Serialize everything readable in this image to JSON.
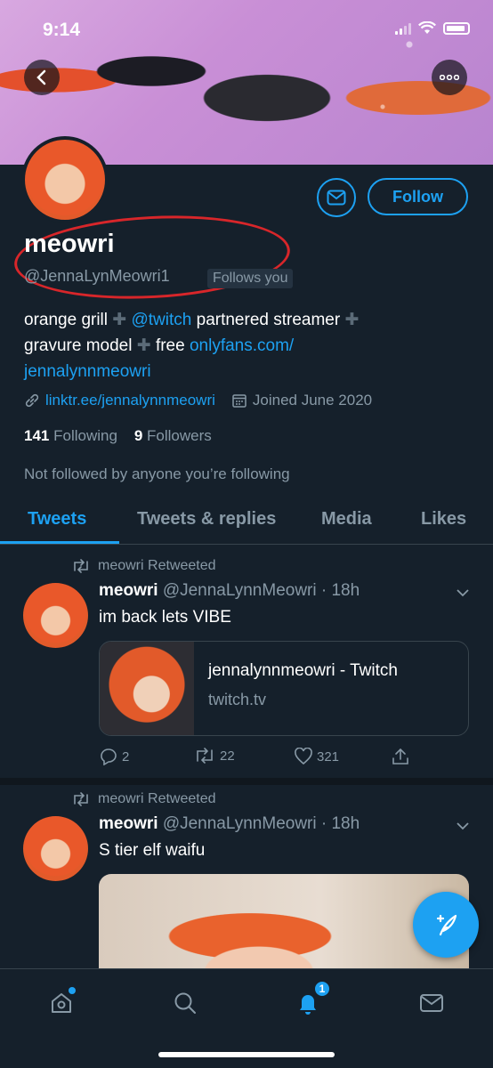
{
  "status_bar": {
    "time": "9:14"
  },
  "profile": {
    "display_name": "meowri",
    "handle": "@JennaLynMeowri1",
    "follows_you": "Follows you",
    "follow_button": "Follow",
    "bio": {
      "line1_a": "orange grill",
      "line1_b": "@twitch",
      "line1_c": "partnered streamer",
      "line2_a": "gravure model",
      "line2_b": "free",
      "line2_c": "onlyfans.com/",
      "line3": "jennalynnmeowri"
    },
    "website": "linktr.ee/jennalynnmeowri",
    "joined": "Joined June 2020",
    "following_count": "141",
    "following_label": "Following",
    "followers_count": "9",
    "followers_label": "Followers",
    "not_followed": "Not followed by anyone you’re following"
  },
  "tabs": [
    {
      "label": "Tweets",
      "active": true
    },
    {
      "label": "Tweets & replies",
      "active": false
    },
    {
      "label": "Media",
      "active": false
    },
    {
      "label": "Likes",
      "active": false
    }
  ],
  "tweets": [
    {
      "retweet_label": "meowri Retweeted",
      "name": "meowri",
      "handle_time": "@JennaLynnMeowri · 18h",
      "text": "im back lets VIBE",
      "card": {
        "title": "jennalynnmeowri - Twitch",
        "domain": "twitch.tv"
      },
      "replies": "2",
      "retweets": "22",
      "likes": "321"
    },
    {
      "retweet_label": "meowri Retweeted",
      "name": "meowri",
      "handle_time": "@JennaLynnMeowri · 18h",
      "text": "S tier elf waifu"
    }
  ],
  "bottom_nav": {
    "notifications_badge": "1"
  },
  "colors": {
    "background": "#15202b",
    "accent": "#1da1f2",
    "muted": "#8899a6",
    "annotation": "#d8262a"
  }
}
